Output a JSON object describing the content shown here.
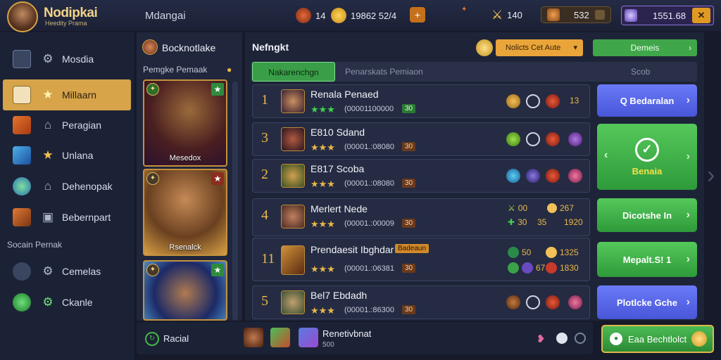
{
  "header": {
    "logo_title": "Nodipkai",
    "logo_sub": "Heedity Prama",
    "name": "Mdangai",
    "res1": "14",
    "res2": "19862 52/4",
    "res3": "140",
    "res4": "532",
    "res5": "1551.68"
  },
  "sidebar": {
    "items": [
      {
        "label": "Mosdia"
      },
      {
        "label": "Millaarn"
      },
      {
        "label": "Peragian"
      },
      {
        "label": "Unlana"
      },
      {
        "label": "Dehenopak"
      },
      {
        "label": "Bebernpart"
      },
      {
        "label": "Cemelas"
      },
      {
        "label": "Ckanle"
      }
    ],
    "section": "Socain Pernak"
  },
  "heroes": {
    "title": "Bocknotlake",
    "subtitle": "Pemgke Pemaak",
    "cards": [
      {
        "name": "Mesedox"
      },
      {
        "name": "Rsenalck"
      },
      {
        "name": ""
      }
    ]
  },
  "main": {
    "title": "Nefngkt",
    "dropdown": "Nolicts Cet Aute",
    "green_btn": "Demeis",
    "tabs": [
      "Nakarenchgn",
      "Penarskats Pemiaon",
      "Scob"
    ],
    "rows": [
      {
        "rank": "1",
        "name": "Renala Penaed",
        "score": "(00001100000",
        "lv": "30",
        "s1": "13"
      },
      {
        "rank": "3",
        "name": "E810 Sdand",
        "score": "(00001.:08080",
        "lv": "30",
        "s1": ""
      },
      {
        "rank": "2",
        "name": "E817 Scoba",
        "score": "(00001.:08080",
        "lv": "30",
        "s1": ""
      },
      {
        "rank": "4",
        "name": "Merlert Nede",
        "score": "(00001.:00009",
        "lv": "30",
        "a": "00",
        "b": "267",
        "c": "30",
        "d": "35",
        "e": "1920"
      },
      {
        "rank": "11",
        "name": "Prendaesit Ibghdar",
        "badge": "Badeaun",
        "score": "(00001.:06381",
        "lv": "30",
        "a": "50",
        "b": "1325",
        "c": "67",
        "d": "1830"
      },
      {
        "rank": "5",
        "name": "Bel7 Ebdadh",
        "score": "(00001.:86300",
        "lv": "30"
      }
    ],
    "actions": [
      "Q Bedaralan",
      "Benaia",
      "Dicotshe In",
      "Mepalt.S! 1",
      "Plotlcke Gche"
    ]
  },
  "bottom": {
    "label": "Racial",
    "player": "Renetivbnat",
    "sub": "500",
    "cta": "Eaa Bechtlolct"
  },
  "colors": {
    "gold": "#e8b84a",
    "green": "#45b649",
    "blue": "#5a6cf0"
  }
}
